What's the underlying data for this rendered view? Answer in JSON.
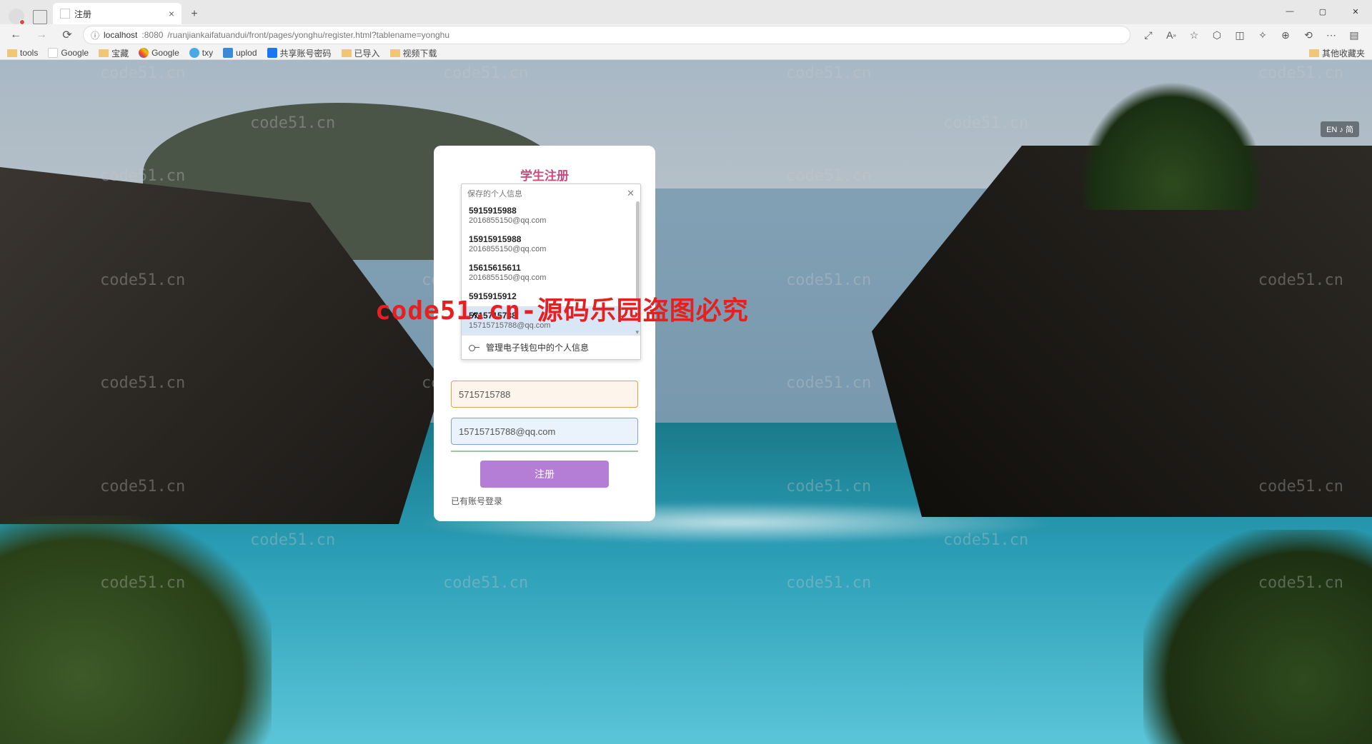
{
  "browser": {
    "tab_title": "注册",
    "url_host": "localhost",
    "url_port": ":8080",
    "url_path": "/ruanjiankaifatuandui/front/pages/yonghu/register.html?tablename=yonghu",
    "win_min": "—",
    "win_max": "▢",
    "win_close": "✕"
  },
  "bookmarks": [
    {
      "label": "tools",
      "type": "folder"
    },
    {
      "label": "Google",
      "type": "page"
    },
    {
      "label": "宝藏",
      "type": "folder"
    },
    {
      "label": "Google",
      "type": "g"
    },
    {
      "label": "txy",
      "type": "cloud"
    },
    {
      "label": "uplod",
      "type": "up"
    },
    {
      "label": "共享账号密码",
      "type": "fb"
    },
    {
      "label": "已导入",
      "type": "folder"
    },
    {
      "label": "视频下载",
      "type": "folder"
    }
  ],
  "bookmark_right": "其他收藏夹",
  "side_indicator": "EN ♪ 简",
  "card": {
    "title": "学生注册",
    "phone_value": "5715715788",
    "email_value": "15715715788@qq.com",
    "register_label": "注册",
    "login_link": "已有账号登录"
  },
  "autofill": {
    "header": "保存的个人信息",
    "items": [
      {
        "name": "5915915988",
        "email": "2016855150@qq.com"
      },
      {
        "name": "15915915988",
        "email": "2016855150@qq.com"
      },
      {
        "name": "15615615611",
        "email": "2016855150@qq.com"
      },
      {
        "name": "5915915912",
        "email": ""
      },
      {
        "name": "5715715788",
        "email": "15715715788@qq.com"
      }
    ],
    "selected_index": 4,
    "footer": "管理电子钱包中的个人信息"
  },
  "watermark_text": "code51.cn",
  "watermark_red": "code51.cn-源码乐园盗图必究"
}
